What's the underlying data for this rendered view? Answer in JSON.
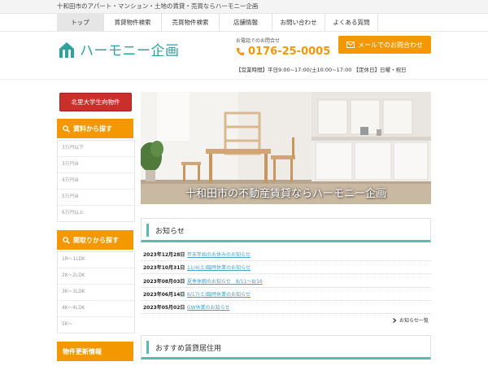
{
  "topbar": {
    "text": "十和田市のアパート・マンション・土地の賃貸・売買ならハーモニー企画"
  },
  "nav": [
    {
      "label": "トップ"
    },
    {
      "label": "賃貸物件検索"
    },
    {
      "label": "売買物件検索"
    },
    {
      "label": "店舗情報"
    },
    {
      "label": "お問い合わせ"
    },
    {
      "label": "よくある質問"
    }
  ],
  "header": {
    "logo_text": "ハーモニー企画",
    "tel_caption": "お電話でのお問合せ",
    "tel": "0176-25-0005",
    "mail_button": "メールでのお問合わせ",
    "hours": "【営業時間】平日9:00~17:00/土10:00~17:00 【定休日】日曜・祝日"
  },
  "sidebar": {
    "special": "北里大学生向物件",
    "rent": {
      "title": "賃料から探す",
      "items": [
        "3万円以下",
        "3万円台",
        "4万円台",
        "5万円台",
        "6万円以上"
      ]
    },
    "layout": {
      "title": "間取りから探す",
      "items": [
        "1R～1LDK",
        "2K～2LDK",
        "3K～3LDK",
        "4K～4LDK",
        "5K～"
      ]
    },
    "updates": {
      "title": "物件更新情報"
    }
  },
  "hero": {
    "caption": "十和田市の不動産賃貸ならハーモニー企画"
  },
  "news": {
    "title": "お知らせ",
    "items": [
      {
        "date": "2023年12月28日",
        "title": "年末年始のお休みのお知らせ"
      },
      {
        "date": "2023年10月31日",
        "title": "11/4(土)臨時休業のお知らせ"
      },
      {
        "date": "2023年08月03日",
        "title": "夏季休暇のお知らせ　8/11～8/16"
      },
      {
        "date": "2023年06月14日",
        "title": "6/17(土)臨時休業のお知らせ"
      },
      {
        "date": "2023年05月02日",
        "title": "GW休業のお知らせ"
      }
    ],
    "more": "お知らせ一覧"
  },
  "recommend": {
    "title": "おすすめ賃貸居住用"
  },
  "colors": {
    "accent": "#f39800",
    "teal": "#2fa29f",
    "special": "#c9302c",
    "link": "#4a9fc7"
  }
}
